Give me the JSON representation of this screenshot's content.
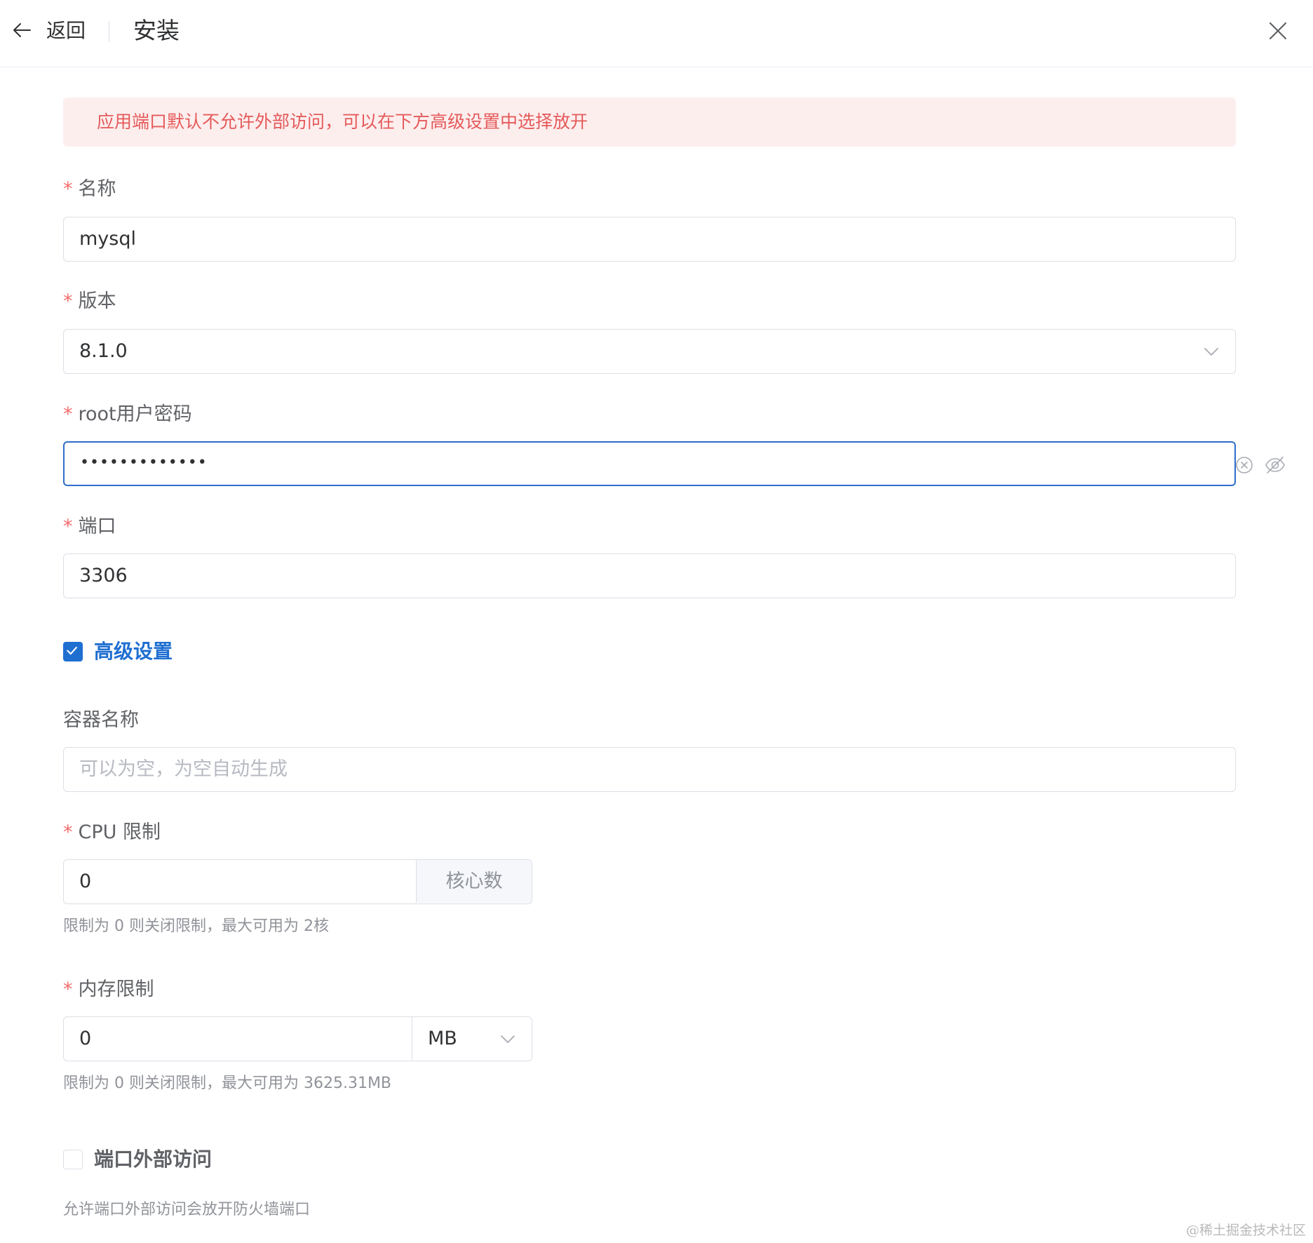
{
  "header": {
    "back_label": "返回",
    "title": "安装"
  },
  "alert": {
    "text": "应用端口默认不允许外部访问，可以在下方高级设置中选择放开",
    "color": "#e55a5a"
  },
  "form": {
    "required_mark": "*",
    "name": {
      "label": "名称",
      "value": "mysql"
    },
    "version": {
      "label": "版本",
      "value": "8.1.0"
    },
    "password": {
      "label": "root用户密码",
      "value": "•••••••••••••"
    },
    "port": {
      "label": "端口",
      "value": "3306"
    },
    "advanced": {
      "label": "高级设置",
      "checked": true
    },
    "container_name": {
      "label": "容器名称",
      "placeholder": "可以为空，为空自动生成"
    },
    "cpu_limit": {
      "label": "CPU 限制",
      "value": "0",
      "unit": "核心数",
      "hint": "限制为 0 则关闭限制，最大可用为 2核"
    },
    "memory_limit": {
      "label": "内存限制",
      "value": "0",
      "unit": "MB",
      "hint": "限制为 0 则关闭限制，最大可用为 3625.31MB"
    },
    "external_access": {
      "label": "端口外部访问",
      "checked": false,
      "hint": "允许端口外部访问会放开防火墙端口"
    }
  },
  "watermark": "@稀土掘金技术社区",
  "colors": {
    "primary": "#1f6fd1",
    "focus_border": "#2d6ec9",
    "danger": "#f56c6c",
    "alert_bg": "#fdeeee"
  }
}
